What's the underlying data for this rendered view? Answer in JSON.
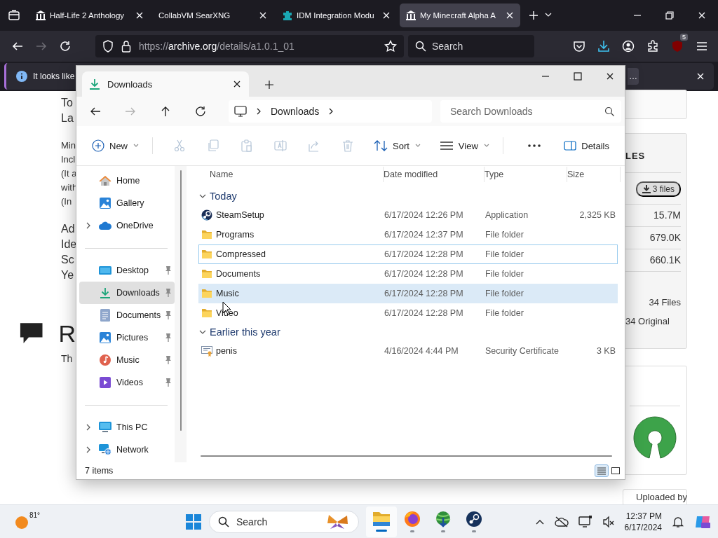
{
  "browser": {
    "tabs": [
      {
        "title": "Half-Life 2 Anthology",
        "kind": "archive",
        "selected": false
      },
      {
        "title": "CollabVM SearXNG",
        "kind": "plain",
        "selected": false
      },
      {
        "title": "IDM Integration Modu",
        "kind": "idm",
        "selected": false
      },
      {
        "title": "My Minecraft Alpha A",
        "kind": "archive",
        "selected": true
      }
    ],
    "url": {
      "scheme": "https://",
      "domain": "archive.org",
      "path": "/details/a1.0.1_01"
    },
    "search": {
      "placeholder": "Search"
    },
    "extension_badge": "5"
  },
  "notification": {
    "message": "It looks like",
    "button": "…"
  },
  "page": {
    "left_groups": [
      {
        "kind": "large",
        "lines": [
          "To",
          "La"
        ]
      },
      {
        "kind": "small",
        "lines": [
          "Min",
          "Incl",
          "(It a",
          "with",
          "(In"
        ]
      },
      {
        "kind": "large",
        "lines": [
          "Ad",
          "Ide",
          "Sc",
          "Ye"
        ]
      }
    ],
    "heading": "R",
    "intro": "Th",
    "files_panel": {
      "heading": "LES",
      "download_button": "3 files",
      "sizes": [
        "15.7M",
        "679.0K",
        "660.1K"
      ],
      "count": "34 Files",
      "original": "34 Original"
    },
    "uploader_label": "Uploaded by"
  },
  "explorer": {
    "tabs": [
      {
        "title": "Downloads",
        "selected": true
      }
    ],
    "breadcrumb": [
      "Downloads"
    ],
    "search": {
      "placeholder": "Search Downloads"
    },
    "toolbar": [
      {
        "kind": "new",
        "label": "New",
        "disabled": false
      },
      {
        "kind": "cut",
        "disabled": true
      },
      {
        "kind": "copy",
        "disabled": true
      },
      {
        "kind": "paste",
        "disabled": true
      },
      {
        "kind": "rename",
        "disabled": true
      },
      {
        "kind": "share",
        "disabled": true
      },
      {
        "kind": "delete",
        "disabled": true
      },
      {
        "kind": "sort",
        "label": "Sort",
        "disabled": false
      },
      {
        "kind": "view",
        "label": "View",
        "disabled": false
      },
      {
        "kind": "more",
        "disabled": false
      }
    ],
    "details_button": "Details",
    "nav_sections": [
      {
        "items": [
          {
            "label": "Home",
            "kind": "home",
            "expandable": false,
            "pinned": false,
            "selected": false
          },
          {
            "label": "Gallery",
            "kind": "gallery",
            "expandable": false,
            "pinned": false,
            "selected": false
          },
          {
            "label": "OneDrive",
            "kind": "cloud",
            "expandable": true,
            "pinned": false,
            "selected": false
          }
        ]
      },
      {
        "items": [
          {
            "label": "Desktop",
            "kind": "desktop",
            "expandable": false,
            "pinned": true,
            "selected": false
          },
          {
            "label": "Downloads",
            "kind": "download",
            "expandable": false,
            "pinned": true,
            "selected": true
          },
          {
            "label": "Documents",
            "kind": "documents",
            "expandable": false,
            "pinned": true,
            "selected": false
          },
          {
            "label": "Pictures",
            "kind": "pictures",
            "expandable": false,
            "pinned": true,
            "selected": false
          },
          {
            "label": "Music",
            "kind": "music",
            "expandable": false,
            "pinned": true,
            "selected": false
          },
          {
            "label": "Videos",
            "kind": "videos",
            "expandable": false,
            "pinned": true,
            "selected": false
          }
        ]
      },
      {
        "items": [
          {
            "label": "This PC",
            "kind": "pc",
            "expandable": true,
            "pinned": false,
            "selected": false
          },
          {
            "label": "Network",
            "kind": "network",
            "expandable": true,
            "pinned": false,
            "selected": false
          }
        ]
      }
    ],
    "columns": [
      "Name",
      "Date modified",
      "Type",
      "Size"
    ],
    "groups": [
      {
        "title": "Today",
        "expanded": true,
        "rows": [
          {
            "name": "SteamSetup",
            "kind": "app",
            "date": "6/17/2024 12:26 PM",
            "type": "Application",
            "size": "2,325 KB",
            "selected": false,
            "focused": false
          },
          {
            "name": "Programs",
            "kind": "folder",
            "date": "6/17/2024 12:37 PM",
            "type": "File folder",
            "selected": false,
            "focused": false
          },
          {
            "name": "Compressed",
            "kind": "folder",
            "date": "6/17/2024 12:28 PM",
            "type": "File folder",
            "selected": false,
            "focused": true
          },
          {
            "name": "Documents",
            "kind": "folder",
            "date": "6/17/2024 12:28 PM",
            "type": "File folder",
            "selected": false,
            "focused": false
          },
          {
            "name": "Music",
            "kind": "folder",
            "date": "6/17/2024 12:28 PM",
            "type": "File folder",
            "selected": true,
            "focused": false
          },
          {
            "name": "Video",
            "kind": "folder",
            "date": "6/17/2024 12:28 PM",
            "type": "File folder",
            "selected": false,
            "focused": false
          }
        ]
      },
      {
        "title": "Earlier this year",
        "expanded": true,
        "rows": [
          {
            "name": "penis",
            "kind": "certificate",
            "date": "4/16/2024 4:44 PM",
            "type": "Security Certificate",
            "size": "3 KB",
            "selected": false,
            "focused": false
          }
        ]
      }
    ],
    "status": "7 items",
    "view_modes": [
      {
        "kind": "details",
        "selected": true
      },
      {
        "kind": "tiles",
        "selected": false
      }
    ]
  },
  "taskbar": {
    "weather": "81°",
    "search": {
      "placeholder": "Search"
    },
    "apps": [
      {
        "kind": "explorer",
        "active": true
      },
      {
        "kind": "firefox",
        "active": false
      },
      {
        "kind": "idm",
        "active": false
      },
      {
        "kind": "steam",
        "active": false
      }
    ],
    "time": "12:37 PM",
    "date": "6/17/2024"
  }
}
